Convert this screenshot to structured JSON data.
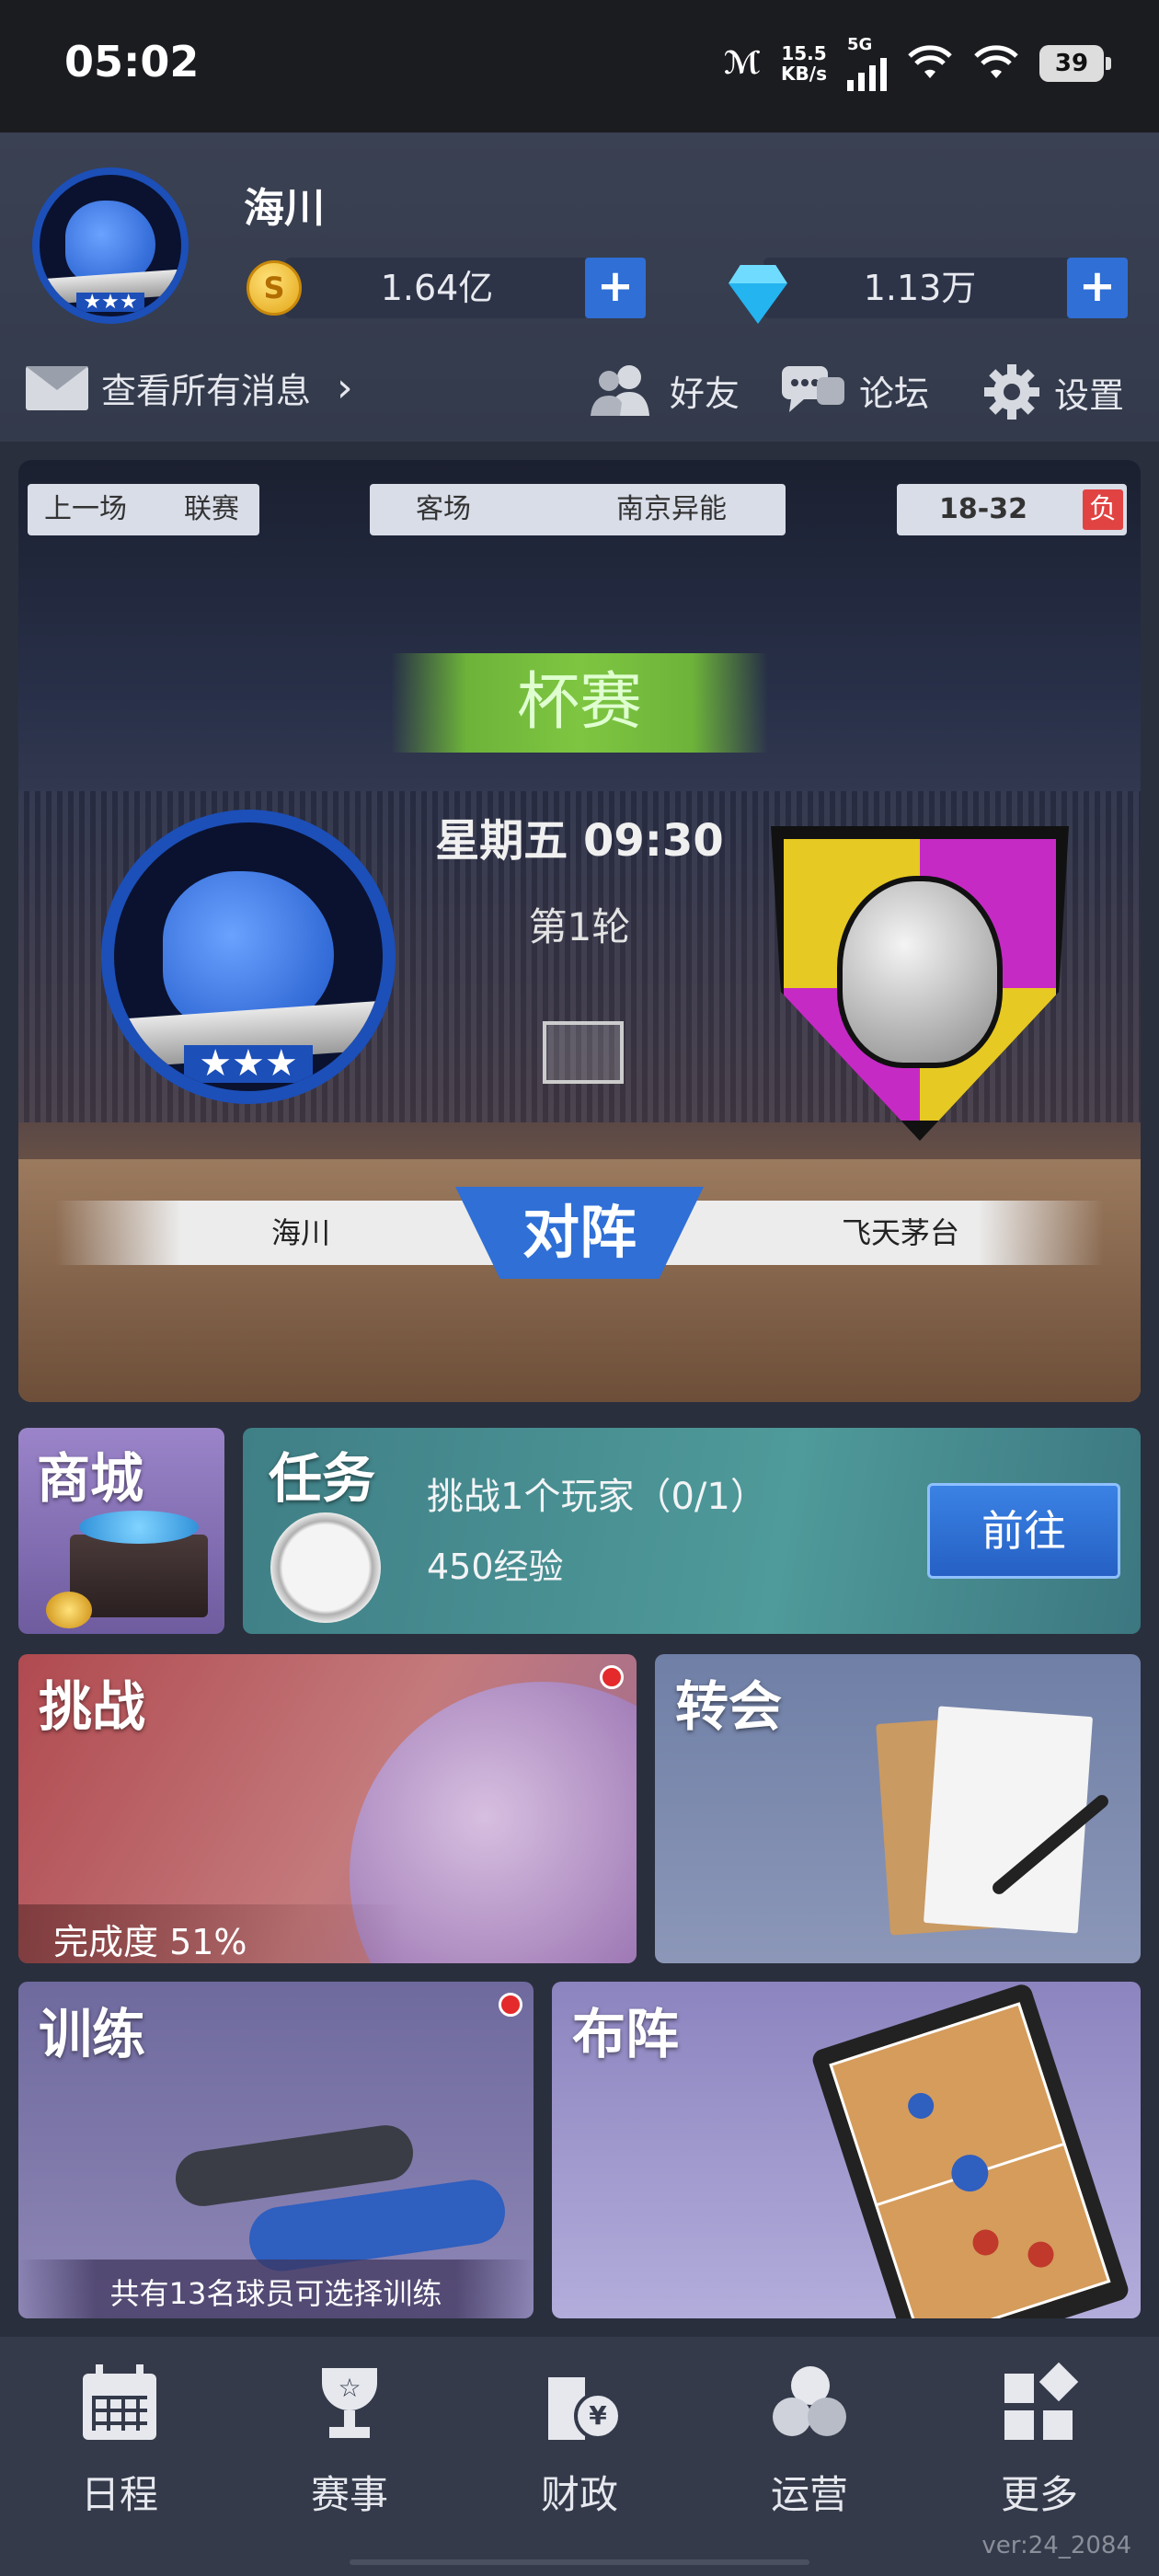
{
  "status_bar": {
    "time": "05:02",
    "net_speed_value": "15.5",
    "net_speed_unit": "KB/s",
    "network": "5G",
    "battery": "39"
  },
  "profile": {
    "name": "海川",
    "coins": "1.64亿",
    "diamonds": "1.13万",
    "add_label": "+"
  },
  "top_menu": {
    "messages": "查看所有消息",
    "messages_arrow": "›",
    "friends": "好友",
    "forum": "论坛",
    "settings": "设置"
  },
  "match": {
    "last_match_label": "上一场",
    "last_match_type": "联赛",
    "venue": "客场",
    "opponent_last": "南京异能",
    "last_score": "18-32",
    "last_result": "负",
    "competition": "杯赛",
    "time": "星期五 09:30",
    "round": "第1轮",
    "home_team": "海川",
    "away_team": "飞天茅台",
    "vs_label": "对阵"
  },
  "tiles": {
    "shop": "商城",
    "task": {
      "title": "任务",
      "description": "挑战1个玩家（0/1）",
      "reward": "450经验",
      "button": "前往"
    },
    "challenge": {
      "title": "挑战",
      "progress": "完成度 51%"
    },
    "transfer": {
      "title": "转会"
    },
    "training": {
      "title": "训练",
      "note": "共有13名球员可选择训练"
    },
    "lineup": {
      "title": "布阵"
    }
  },
  "bottom_nav": {
    "items": [
      {
        "label": "日程",
        "icon": "calendar-icon"
      },
      {
        "label": "赛事",
        "icon": "trophy-icon"
      },
      {
        "label": "财政",
        "icon": "finance-icon"
      },
      {
        "label": "运营",
        "icon": "operations-icon"
      },
      {
        "label": "更多",
        "icon": "more-icon"
      }
    ]
  },
  "version": "ver:24_2084",
  "colors": {
    "accent_blue": "#2f6fd6",
    "cup_green": "#7ec641",
    "loss_red": "#e14343",
    "badge_red": "#e42a2a"
  }
}
